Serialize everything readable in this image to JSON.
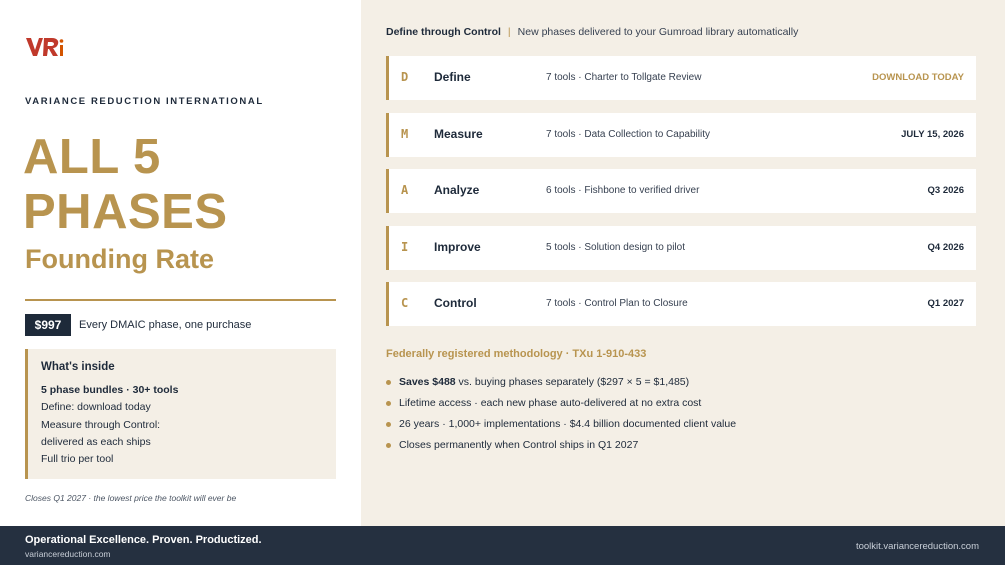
{
  "brand": {
    "logo_text": "VRi",
    "company": "VARIANCE REDUCTION INTERNATIONAL",
    "accent_color": "#b8944f",
    "navy_color": "#1e2a3a"
  },
  "hero": {
    "headline_line1": "ALL 5",
    "headline_line2": "PHASES",
    "subhead": "Founding Rate"
  },
  "price": {
    "amount": "$997",
    "description": "Every DMAIC phase, one purchase"
  },
  "inside": {
    "title": "What's inside",
    "lines": [
      "5 phase bundles · 30+ tools",
      "Define: download today",
      "Measure through Control:",
      "delivered as each ships",
      "Full trio per tool"
    ]
  },
  "closing_note": "Closes Q1 2027 · the lowest price the toolkit will ever be",
  "top_line": {
    "label": "Define through Control",
    "separator": "|",
    "text": "New phases delivered to your Gumroad library automatically"
  },
  "phases": [
    {
      "letter": "D",
      "name": "Define",
      "description": "7 tools · Charter to Tollgate Review",
      "date": "DOWNLOAD TODAY"
    },
    {
      "letter": "M",
      "name": "Measure",
      "description": "7 tools · Data Collection to Capability",
      "date": "JULY 15, 2026"
    },
    {
      "letter": "A",
      "name": "Analyze",
      "description": "6 tools · Fishbone to verified driver",
      "date": "Q3 2026"
    },
    {
      "letter": "I",
      "name": "Improve",
      "description": "5 tools · Solution design to pilot",
      "date": "Q4 2026"
    },
    {
      "letter": "C",
      "name": "Control",
      "description": "7 tools · Control Plan to Closure",
      "date": "Q1 2027"
    }
  ],
  "methodology": "Federally registered methodology · TXu 1-910-433",
  "bullets": [
    {
      "bold": "Saves $488",
      "text": " vs. buying phases separately ($297 × 5 = $1,485)"
    },
    {
      "bold": "",
      "text": "Lifetime access · each new phase auto-delivered at no extra cost"
    },
    {
      "bold": "",
      "text": "26 years · 1,000+ implementations · $4.4 billion documented client value"
    },
    {
      "bold": "",
      "text": "Closes permanently when Control ships in Q1 2027"
    }
  ],
  "footer": {
    "tagline": "Operational Excellence. Proven. Productized.",
    "site": "variancereduction.com",
    "url": "toolkit.variancereduction.com"
  }
}
